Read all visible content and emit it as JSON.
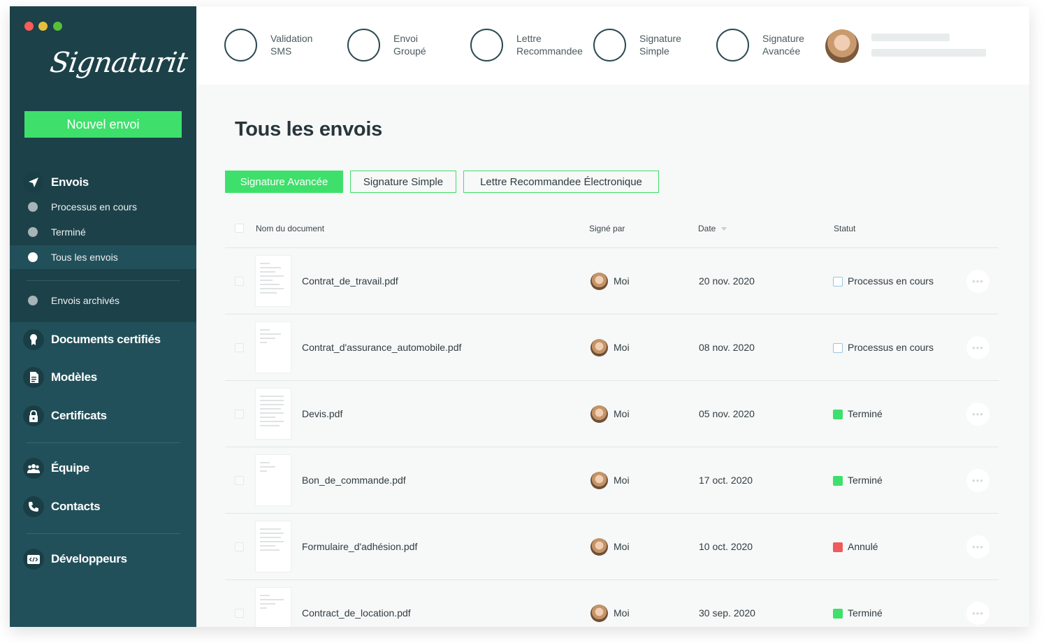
{
  "window": {
    "traffic_lights": [
      "close",
      "minimize",
      "zoom"
    ]
  },
  "brand": {
    "logo_text": "Signaturit",
    "accent_color": "#3ee06b",
    "sidebar_color": "#1c4149"
  },
  "sidebar": {
    "new_button": "Nouvel envoi",
    "envois": {
      "label": "Envois",
      "icon": "paper-plane-icon"
    },
    "sub_items": [
      {
        "label": "Processus en cours"
      },
      {
        "label": "Terminé"
      },
      {
        "label": "Tous les envois",
        "active": true
      },
      {
        "label": "Envois archivés"
      }
    ],
    "sections": [
      {
        "label": "Documents certifiés",
        "icon": "certificate-ribbon-icon"
      },
      {
        "label": "Modèles",
        "icon": "document-icon"
      },
      {
        "label": "Certificats",
        "icon": "lock-icon"
      },
      {
        "label": "Équipe",
        "icon": "team-icon"
      },
      {
        "label": "Contacts",
        "icon": "phone-icon"
      },
      {
        "label": "Développeurs",
        "icon": "code-icon"
      }
    ]
  },
  "topbar": {
    "items": [
      {
        "label": "Validation\nSMS"
      },
      {
        "label": "Envoi\nGroupé"
      },
      {
        "label": "Lettre\nRecommandee"
      },
      {
        "label": "Signature\nSimple"
      },
      {
        "label": "Signature\nAvancée"
      }
    ]
  },
  "main": {
    "title": "Tous les envois",
    "filters": [
      {
        "label": "Signature Avancée",
        "active": true
      },
      {
        "label": "Signature Simple",
        "active": false
      },
      {
        "label": "Lettre Recommandee Électronique",
        "active": false
      }
    ],
    "columns": {
      "name": "Nom du document",
      "signed_by": "Signé par",
      "date": "Date",
      "status": "Statut"
    },
    "rows": [
      {
        "name": "Contrat_de_travail.pdf",
        "signer": "Moi",
        "date": "20 nov. 2020",
        "status": "Processus en cours",
        "status_color": "pending"
      },
      {
        "name": "Contrat_d'assurance_automobile.pdf",
        "signer": "Moi",
        "date": "08 nov. 2020",
        "status": "Processus en cours",
        "status_color": "pending"
      },
      {
        "name": "Devis.pdf",
        "signer": "Moi",
        "date": "05 nov. 2020",
        "status": "Terminé",
        "status_color": "#3ee06b"
      },
      {
        "name": "Bon_de_commande.pdf",
        "signer": "Moi",
        "date": "17 oct. 2020",
        "status": "Terminé",
        "status_color": "#3ee06b"
      },
      {
        "name": "Formulaire_d'adhésion.pdf",
        "signer": "Moi",
        "date": "10 oct. 2020",
        "status": "Annulé",
        "status_color": "#ef5a5a"
      },
      {
        "name": "Contract_de_location.pdf",
        "signer": "Moi",
        "date": "30 sep. 2020",
        "status": "Terminé",
        "status_color": "#3ee06b"
      }
    ]
  }
}
